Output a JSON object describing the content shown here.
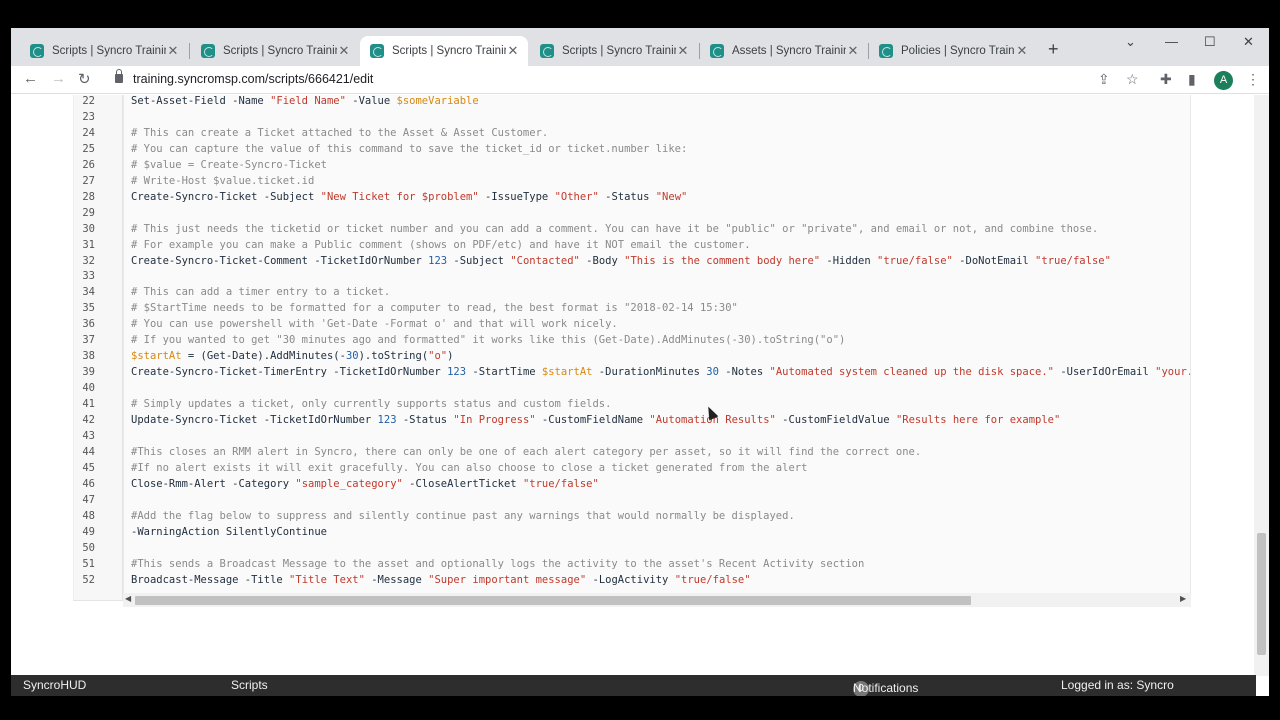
{
  "tabs": [
    {
      "label": "Scripts | Syncro Training",
      "active": false
    },
    {
      "label": "Scripts | Syncro Training",
      "active": false
    },
    {
      "label": "Scripts | Syncro Training",
      "active": true
    },
    {
      "label": "Scripts | Syncro Training",
      "active": false
    },
    {
      "label": "Assets | Syncro Training",
      "active": false
    },
    {
      "label": "Policies | Syncro Training",
      "active": false
    }
  ],
  "toolbar": {
    "url": "training.syncromsp.com/scripts/666421/edit",
    "avatar_letter": "A"
  },
  "editor": {
    "lines": [
      {
        "n": "22",
        "parts": [
          [
            "k",
            "Set-Asset-Field -Name "
          ],
          [
            "s",
            "\"Field Name\""
          ],
          [
            "k",
            " -Value "
          ],
          [
            "v",
            "$someVariable"
          ]
        ]
      },
      {
        "n": "23",
        "parts": []
      },
      {
        "n": "24",
        "parts": [
          [
            "c",
            "# This can create a Ticket attached to the Asset & Asset Customer."
          ]
        ]
      },
      {
        "n": "25",
        "parts": [
          [
            "c",
            "# You can capture the value of this command to save the ticket_id or ticket.number like:"
          ]
        ]
      },
      {
        "n": "26",
        "parts": [
          [
            "c",
            "# $value = Create-Syncro-Ticket"
          ]
        ]
      },
      {
        "n": "27",
        "parts": [
          [
            "c",
            "# Write-Host $value.ticket.id"
          ]
        ]
      },
      {
        "n": "28",
        "parts": [
          [
            "k",
            "Create-Syncro-Ticket -Subject "
          ],
          [
            "s",
            "\"New Ticket for $problem\""
          ],
          [
            "k",
            " -IssueType "
          ],
          [
            "s",
            "\"Other\""
          ],
          [
            "k",
            " -Status "
          ],
          [
            "s",
            "\"New\""
          ]
        ]
      },
      {
        "n": "29",
        "parts": []
      },
      {
        "n": "30",
        "parts": [
          [
            "c",
            "# This just needs the ticketid or ticket number and you can add a comment. You can have it be \"public\" or \"private\", and email or not, and combine those."
          ]
        ]
      },
      {
        "n": "31",
        "parts": [
          [
            "c",
            "# For example you can make a Public comment (shows on PDF/etc) and have it NOT email the customer."
          ]
        ]
      },
      {
        "n": "32",
        "parts": [
          [
            "k",
            "Create-Syncro-Ticket-Comment -TicketIdOrNumber "
          ],
          [
            "n",
            "123"
          ],
          [
            "k",
            " -Subject "
          ],
          [
            "s",
            "\"Contacted\""
          ],
          [
            "k",
            " -Body "
          ],
          [
            "s",
            "\"This is the comment body here\""
          ],
          [
            "k",
            " -Hidden "
          ],
          [
            "s",
            "\"true/false\""
          ],
          [
            "k",
            " -DoNotEmail "
          ],
          [
            "s",
            "\"true/false\""
          ]
        ]
      },
      {
        "n": "33",
        "parts": []
      },
      {
        "n": "34",
        "parts": [
          [
            "c",
            "# This can add a timer entry to a ticket."
          ]
        ]
      },
      {
        "n": "35",
        "parts": [
          [
            "c",
            "# $StartTime needs to be formatted for a computer to read, the best format is \"2018-02-14 15:30\""
          ]
        ]
      },
      {
        "n": "36",
        "parts": [
          [
            "c",
            "# You can use powershell with 'Get-Date -Format o' and that will work nicely."
          ]
        ]
      },
      {
        "n": "37",
        "parts": [
          [
            "c",
            "# If you wanted to get \"30 minutes ago and formatted\" it works like this (Get-Date).AddMinutes(-30).toString(\"o\")"
          ]
        ]
      },
      {
        "n": "38",
        "parts": [
          [
            "v",
            "$startAt"
          ],
          [
            "k",
            " = (Get-Date).AddMinutes(-"
          ],
          [
            "n",
            "30"
          ],
          [
            "k",
            ").toString("
          ],
          [
            "s",
            "\"o\""
          ],
          [
            "k",
            ")"
          ]
        ]
      },
      {
        "n": "39",
        "parts": [
          [
            "k",
            "Create-Syncro-Ticket-TimerEntry -TicketIdOrNumber "
          ],
          [
            "n",
            "123"
          ],
          [
            "k",
            " -StartTime "
          ],
          [
            "v",
            "$startAt"
          ],
          [
            "k",
            " -DurationMinutes "
          ],
          [
            "n",
            "30"
          ],
          [
            "k",
            " -Notes "
          ],
          [
            "s",
            "\"Automated system cleaned up the disk space.\""
          ],
          [
            "k",
            " -UserIdOrEmail "
          ],
          [
            "s",
            "\"your.user"
          ]
        ]
      },
      {
        "n": "40",
        "parts": []
      },
      {
        "n": "41",
        "parts": [
          [
            "c",
            "# Simply updates a ticket, only currently supports status and custom fields."
          ]
        ]
      },
      {
        "n": "42",
        "parts": [
          [
            "k",
            "Update-Syncro-Ticket -TicketIdOrNumber "
          ],
          [
            "n",
            "123"
          ],
          [
            "k",
            " -Status "
          ],
          [
            "s",
            "\"In Progress\""
          ],
          [
            "k",
            " -CustomFieldName "
          ],
          [
            "s",
            "\"Automation Results\""
          ],
          [
            "k",
            " -CustomFieldValue "
          ],
          [
            "s",
            "\"Results here for example\""
          ]
        ]
      },
      {
        "n": "43",
        "parts": []
      },
      {
        "n": "44",
        "parts": [
          [
            "c",
            "#This closes an RMM alert in Syncro, there can only be one of each alert category per asset, so it will find the correct one."
          ]
        ]
      },
      {
        "n": "45",
        "parts": [
          [
            "c",
            "#If no alert exists it will exit gracefully. You can also choose to close a ticket generated from the alert"
          ]
        ]
      },
      {
        "n": "46",
        "parts": [
          [
            "k",
            "Close-Rmm-Alert -Category "
          ],
          [
            "s",
            "\"sample_category\""
          ],
          [
            "k",
            " -CloseAlertTicket "
          ],
          [
            "s",
            "\"true/false\""
          ]
        ]
      },
      {
        "n": "47",
        "parts": []
      },
      {
        "n": "48",
        "parts": [
          [
            "c",
            "#Add the flag below to suppress and silently continue past any warnings that would normally be displayed."
          ]
        ]
      },
      {
        "n": "49",
        "parts": [
          [
            "k",
            "-WarningAction SilentlyContinue"
          ]
        ]
      },
      {
        "n": "50",
        "parts": []
      },
      {
        "n": "51",
        "parts": [
          [
            "c",
            "#This sends a Broadcast Message to the asset and optionally logs the activity to the asset's Recent Activity section"
          ]
        ]
      },
      {
        "n": "52",
        "parts": [
          [
            "k",
            "Broadcast-Message -Title "
          ],
          [
            "s",
            "\"Title Text\""
          ],
          [
            "k",
            " -Message "
          ],
          [
            "s",
            "\"Super important message\""
          ],
          [
            "k",
            " -LogActivity "
          ],
          [
            "s",
            "\"true/false\""
          ]
        ]
      }
    ]
  },
  "statusbar": {
    "app": "SyncroHUD",
    "section": "Scripts",
    "notif_count": "0",
    "notif_label": "Notifications",
    "logged_in": "Logged in as: Syncro"
  }
}
